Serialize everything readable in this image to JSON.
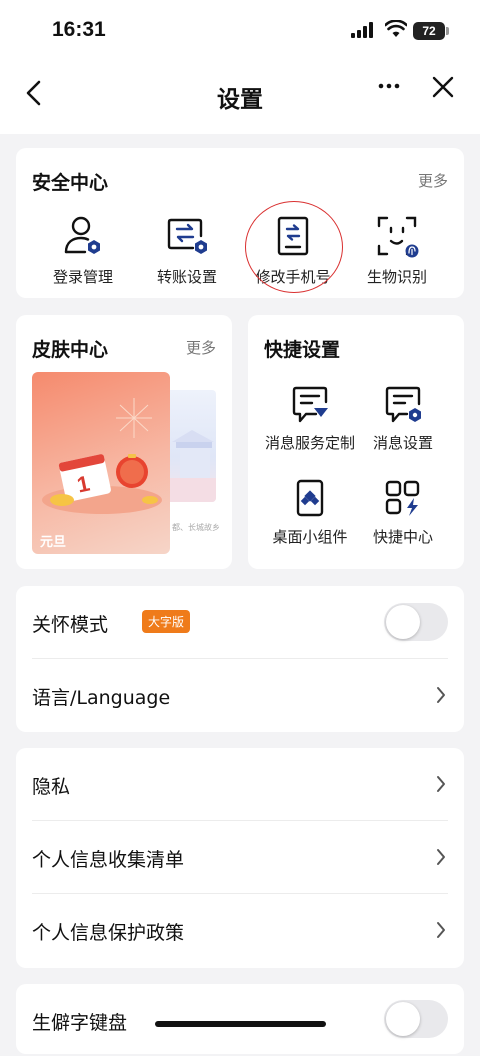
{
  "status_bar": {
    "time": "16:31",
    "battery": "72"
  },
  "nav": {
    "title": "设置"
  },
  "security": {
    "title": "安全中心",
    "more": "更多",
    "items": [
      {
        "label": "登录管理",
        "icon": "user-gear-icon"
      },
      {
        "label": "转账设置",
        "icon": "transfer-gear-icon"
      },
      {
        "label": "修改手机号",
        "icon": "phone-document-icon"
      },
      {
        "label": "生物识别",
        "icon": "face-fingerprint-icon"
      }
    ]
  },
  "skin": {
    "title": "皮肤中心",
    "more": "更多",
    "theme_label": "元旦",
    "theme2_caption": "都、长城故乡",
    "date_number": "1"
  },
  "shortcuts": {
    "title": "快捷设置",
    "items": [
      {
        "label": "消息服务定制",
        "icon": "message-custom-icon"
      },
      {
        "label": "消息设置",
        "icon": "message-gear-icon"
      },
      {
        "label": "桌面小组件",
        "icon": "phone-widget-icon"
      },
      {
        "label": "快捷中心",
        "icon": "grid-bolt-icon"
      }
    ]
  },
  "group1": {
    "care_mode": {
      "label": "关怀模式",
      "badge": "大字版",
      "enabled": false
    },
    "language": {
      "label": "语言/Language"
    }
  },
  "group2": {
    "privacy": {
      "label": "隐私"
    },
    "info_list": {
      "label": "个人信息收集清单"
    },
    "info_policy": {
      "label": "个人信息保护政策"
    }
  },
  "group3": {
    "rare_keyboard": {
      "label": "生僻字键盘",
      "enabled": false
    }
  },
  "colors": {
    "accent": "#1f3c8f",
    "badge": "#ef7b1a",
    "highlight": "#d93030"
  }
}
